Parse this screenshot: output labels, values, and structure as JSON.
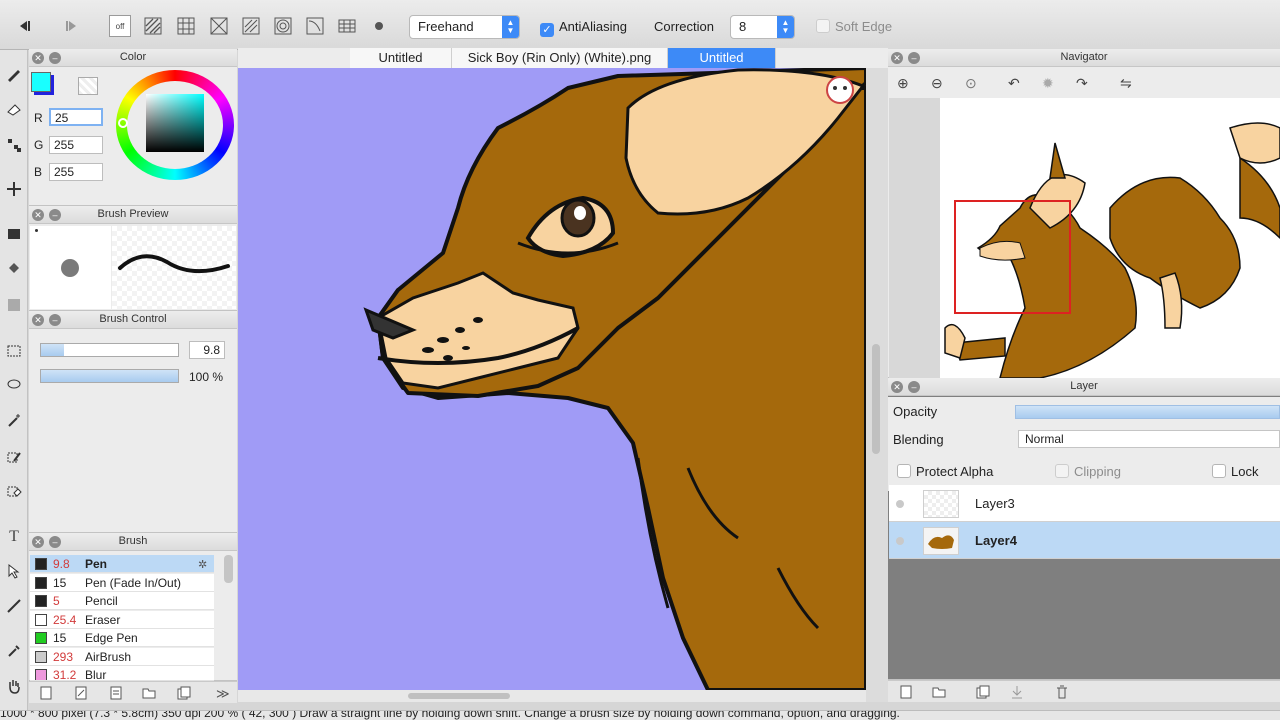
{
  "toolbar": {
    "mode_select": "Freehand",
    "antialiasing_label": "AntiAliasing",
    "antialiasing_checked": true,
    "correction_label": "Correction",
    "correction_value": "8",
    "soft_edge_label": "Soft Edge",
    "soft_edge_checked": false,
    "off_label": "off"
  },
  "color_panel": {
    "title": "Color",
    "r_label": "R",
    "r_value": "25",
    "g_label": "G",
    "g_value": "255",
    "b_label": "B",
    "b_value": "255",
    "primary_color": "#19ffff",
    "secondary_color": "#2222dd"
  },
  "brush_preview": {
    "title": "Brush Preview"
  },
  "brush_control": {
    "title": "Brush Control",
    "size_value": "9.8",
    "opacity_value": "100 %",
    "size_fraction": 0.17,
    "opacity_fraction": 1.0
  },
  "brush_panel": {
    "title": "Brush",
    "items": [
      {
        "size": "9.8",
        "name": "Pen",
        "color": "#222222"
      },
      {
        "size": "15",
        "name": "Pen (Fade In/Out)",
        "color": "#222222"
      },
      {
        "size": "5",
        "name": "Pencil",
        "color": "#222222"
      },
      {
        "size": "25.4",
        "name": "Eraser",
        "color": "#ffffff"
      },
      {
        "size": "15",
        "name": "Edge Pen",
        "color": "#22cc22"
      },
      {
        "size": "293",
        "name": "AirBrush",
        "color": "#cccccc"
      },
      {
        "size": "31.2",
        "name": "Blur",
        "color": "#ee99dd"
      }
    ]
  },
  "tabs": [
    {
      "label": "Untitled",
      "active": false
    },
    {
      "label": "Sick Boy (Rin Only) (White).png",
      "active": false
    },
    {
      "label": "Untitled",
      "active": true
    }
  ],
  "navigator": {
    "title": "Navigator"
  },
  "layer_panel": {
    "title": "Layer",
    "opacity_label": "Opacity",
    "blending_label": "Blending",
    "blending_value": "Normal",
    "protect_alpha_label": "Protect Alpha",
    "clipping_label": "Clipping",
    "lock_label": "Lock",
    "layers": [
      {
        "name": "Layer3",
        "selected": false
      },
      {
        "name": "Layer4",
        "selected": true
      }
    ]
  },
  "status_bar": {
    "text": "1000 * 800 pixel   (7.3 * 5.8cm)   350 dpi   200 %   ( 42, 300 )   Draw a straight line by holding down shift. Change a brush size by holding down command, option, and dragging."
  },
  "colors": {
    "canvas_bg": "#a09bf6",
    "fur": "#a5690c",
    "inner_ear": "#f8d3a0",
    "accent": "#3d8af7"
  }
}
